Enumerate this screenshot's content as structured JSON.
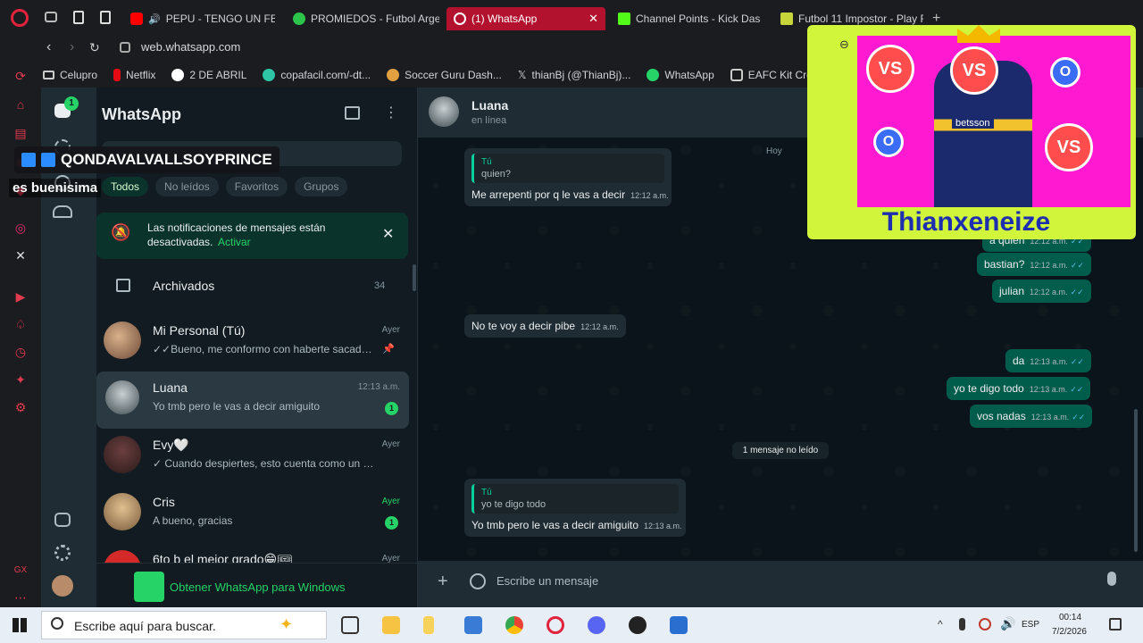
{
  "browser": {
    "tabs": [
      {
        "label": "PEPU - TENGO UN FE",
        "icon": "youtube-icon"
      },
      {
        "label": "PROMIEDOS - Futbol Arge",
        "icon": "promiedos-icon"
      },
      {
        "label": "(1) WhatsApp",
        "icon": "whatsapp-icon",
        "active": true
      },
      {
        "label": "Channel Points - Kick Das",
        "icon": "kick-icon"
      },
      {
        "label": "Futbol 11 Impostor - Play F",
        "icon": "futbol11-icon"
      }
    ],
    "url": "web.whatsapp.com",
    "bookmarks": [
      "Celupro",
      "Netflix",
      "2 DE ABRIL",
      "copafacil.com/-dt...",
      "Soccer Guru Dash...",
      "thianBj (@ThianBj)...",
      "WhatsApp",
      "EAFC Kit Creator"
    ]
  },
  "stream": {
    "chat_user": "QONDAVALVALLSOYPRINCE",
    "chat_message": "es buenisima",
    "streamer_name": "Thianxeneize",
    "vs_label": "VS",
    "o_label": "O",
    "shirt_sponsor": "betsson"
  },
  "sidebar": {
    "title": "WhatsApp",
    "status_badge": "1",
    "filters": [
      "Todos",
      "No leídos",
      "Favoritos",
      "Grupos"
    ],
    "notice": {
      "text": "Las notificaciones de mensajes están desactivadas.",
      "action": "Activar"
    },
    "archived": {
      "label": "Archivados",
      "count": "34"
    },
    "chats": [
      {
        "name": "Mi Personal (Tú)",
        "time": "Ayer",
        "msg": "✓✓Bueno, me conformo con haberte sacado...",
        "pinned": true
      },
      {
        "name": "Luana",
        "time": "12:13 a.m.",
        "msg": "Yo tmb pero le vas a decir amiguito",
        "unread": "1"
      },
      {
        "name": "Evy🤍",
        "time": "Ayer",
        "msg": "✓ Cuando despiertes, esto cuenta como un hol..."
      },
      {
        "name": "Cris",
        "time": "Ayer",
        "msg": "A bueno, gracias",
        "unread": "1"
      },
      {
        "name": "6to b el mejor grado😁🎟",
        "time": "Ayer",
        "msg": ""
      }
    ],
    "promo": "Obtener WhatsApp para Windows"
  },
  "chat": {
    "contact_name": "Luana",
    "contact_status": "en línea",
    "date_chip": "Hoy",
    "unread_chip": "1 mensaje no leído",
    "messages": {
      "m1_quote_who": "Tú",
      "m1_quote_txt": "quien?",
      "m1_text": "Me arrepenti por q le vas a decir",
      "m1_time": "12:12 a.m.",
      "m2_text": "a quien",
      "m2_time": "12:12 a.m.",
      "m3_text": "bastian?",
      "m3_time": "12:12 a.m.",
      "m4_text": "julian",
      "m4_time": "12:12 a.m.",
      "m5_text": "No te voy a decir pibe",
      "m5_time": "12:12 a.m.",
      "m6_text": "da",
      "m6_time": "12:13 a.m.",
      "m7_text": "yo te digo todo",
      "m7_time": "12:13 a.m.",
      "m8_text": "vos nadas",
      "m8_time": "12:13 a.m.",
      "m9_quote_who": "Tú",
      "m9_quote_txt": "yo te digo todo",
      "m9_text": "Yo tmb pero le vas a decir amiguito",
      "m9_time": "12:13 a.m."
    },
    "composer_placeholder": "Escribe un mensaje"
  },
  "taskbar": {
    "search_placeholder": "Escribe aquí para buscar.",
    "lang": "ESP",
    "time": "00:14",
    "date": "7/2/2026"
  },
  "colors": {
    "wa_green": "#25d366",
    "out_bubble": "#005c4b",
    "in_bubble": "#202c33",
    "active_tab": "#b3122e",
    "overlay_lime": "#d0f53b",
    "overlay_magenta": "#ff19d0"
  }
}
